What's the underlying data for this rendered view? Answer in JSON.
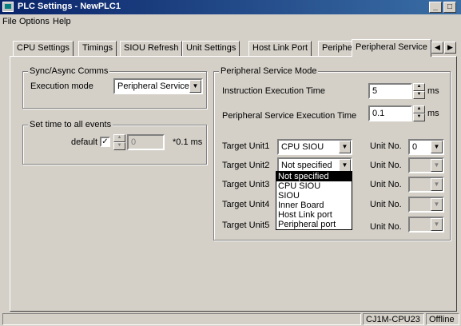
{
  "window": {
    "title": "PLC Settings - NewPLC1"
  },
  "menu": [
    "File",
    "Options",
    "Help"
  ],
  "tabs": [
    "CPU Settings",
    "Timings",
    "SIOU Refresh",
    "Unit Settings",
    "Host Link Port",
    "Peripheral Port",
    "Peripheral Service"
  ],
  "active_tab": "Peripheral Service",
  "sync": {
    "title": "Sync/Async Comms",
    "exec_label": "Execution mode",
    "exec_value": "Peripheral Service"
  },
  "events": {
    "title": "Set time to all events",
    "default_label": "default",
    "default_checked": "☑",
    "value": "0",
    "unit": "*0.1 ms"
  },
  "mode": {
    "title": "Peripheral Service Mode",
    "instr_label": "Instruction Execution Time",
    "instr_value": "5",
    "instr_unit": "ms",
    "periph_label": "Peripheral Service Execution Time",
    "periph_value": "0.1",
    "periph_unit": "ms",
    "unit_no_label": "Unit No.",
    "targets": [
      {
        "label": "Target Unit1",
        "value": "CPU SIOU",
        "unit_no": "0"
      },
      {
        "label": "Target Unit2",
        "value": "Not specified",
        "unit_no": ""
      },
      {
        "label": "Target Unit3",
        "value": "",
        "unit_no": ""
      },
      {
        "label": "Target Unit4",
        "value": "",
        "unit_no": ""
      },
      {
        "label": "Target Unit5",
        "value": "",
        "unit_no": ""
      }
    ],
    "dropdown_options": [
      "Not specified",
      "CPU SIOU",
      "SIOU",
      "Inner Board",
      "Host Link port",
      "Peripheral port"
    ]
  },
  "status": {
    "model": "CJ1M-CPU23",
    "state": "Offline"
  },
  "colors": {
    "face": "#d4d0c8",
    "title_start": "#0a246a",
    "title_end": "#3a6ea5",
    "selection": "#000000"
  }
}
